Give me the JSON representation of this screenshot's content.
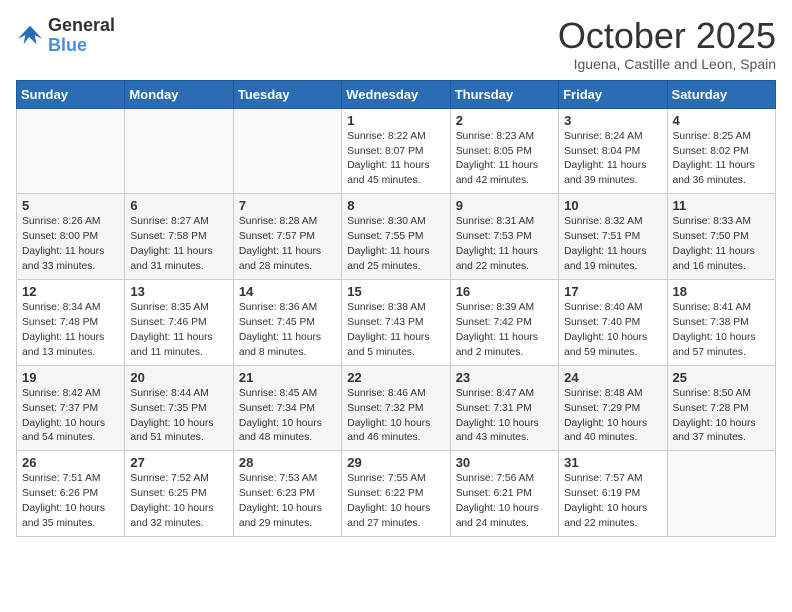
{
  "header": {
    "logo_line1": "General",
    "logo_line2": "Blue",
    "month_title": "October 2025",
    "subtitle": "Iguena, Castille and Leon, Spain"
  },
  "weekdays": [
    "Sunday",
    "Monday",
    "Tuesday",
    "Wednesday",
    "Thursday",
    "Friday",
    "Saturday"
  ],
  "weeks": [
    [
      {
        "day": "",
        "info": ""
      },
      {
        "day": "",
        "info": ""
      },
      {
        "day": "",
        "info": ""
      },
      {
        "day": "1",
        "info": "Sunrise: 8:22 AM\nSunset: 8:07 PM\nDaylight: 11 hours and 45 minutes."
      },
      {
        "day": "2",
        "info": "Sunrise: 8:23 AM\nSunset: 8:05 PM\nDaylight: 11 hours and 42 minutes."
      },
      {
        "day": "3",
        "info": "Sunrise: 8:24 AM\nSunset: 8:04 PM\nDaylight: 11 hours and 39 minutes."
      },
      {
        "day": "4",
        "info": "Sunrise: 8:25 AM\nSunset: 8:02 PM\nDaylight: 11 hours and 36 minutes."
      }
    ],
    [
      {
        "day": "5",
        "info": "Sunrise: 8:26 AM\nSunset: 8:00 PM\nDaylight: 11 hours and 33 minutes."
      },
      {
        "day": "6",
        "info": "Sunrise: 8:27 AM\nSunset: 7:58 PM\nDaylight: 11 hours and 31 minutes."
      },
      {
        "day": "7",
        "info": "Sunrise: 8:28 AM\nSunset: 7:57 PM\nDaylight: 11 hours and 28 minutes."
      },
      {
        "day": "8",
        "info": "Sunrise: 8:30 AM\nSunset: 7:55 PM\nDaylight: 11 hours and 25 minutes."
      },
      {
        "day": "9",
        "info": "Sunrise: 8:31 AM\nSunset: 7:53 PM\nDaylight: 11 hours and 22 minutes."
      },
      {
        "day": "10",
        "info": "Sunrise: 8:32 AM\nSunset: 7:51 PM\nDaylight: 11 hours and 19 minutes."
      },
      {
        "day": "11",
        "info": "Sunrise: 8:33 AM\nSunset: 7:50 PM\nDaylight: 11 hours and 16 minutes."
      }
    ],
    [
      {
        "day": "12",
        "info": "Sunrise: 8:34 AM\nSunset: 7:48 PM\nDaylight: 11 hours and 13 minutes."
      },
      {
        "day": "13",
        "info": "Sunrise: 8:35 AM\nSunset: 7:46 PM\nDaylight: 11 hours and 11 minutes."
      },
      {
        "day": "14",
        "info": "Sunrise: 8:36 AM\nSunset: 7:45 PM\nDaylight: 11 hours and 8 minutes."
      },
      {
        "day": "15",
        "info": "Sunrise: 8:38 AM\nSunset: 7:43 PM\nDaylight: 11 hours and 5 minutes."
      },
      {
        "day": "16",
        "info": "Sunrise: 8:39 AM\nSunset: 7:42 PM\nDaylight: 11 hours and 2 minutes."
      },
      {
        "day": "17",
        "info": "Sunrise: 8:40 AM\nSunset: 7:40 PM\nDaylight: 10 hours and 59 minutes."
      },
      {
        "day": "18",
        "info": "Sunrise: 8:41 AM\nSunset: 7:38 PM\nDaylight: 10 hours and 57 minutes."
      }
    ],
    [
      {
        "day": "19",
        "info": "Sunrise: 8:42 AM\nSunset: 7:37 PM\nDaylight: 10 hours and 54 minutes."
      },
      {
        "day": "20",
        "info": "Sunrise: 8:44 AM\nSunset: 7:35 PM\nDaylight: 10 hours and 51 minutes."
      },
      {
        "day": "21",
        "info": "Sunrise: 8:45 AM\nSunset: 7:34 PM\nDaylight: 10 hours and 48 minutes."
      },
      {
        "day": "22",
        "info": "Sunrise: 8:46 AM\nSunset: 7:32 PM\nDaylight: 10 hours and 46 minutes."
      },
      {
        "day": "23",
        "info": "Sunrise: 8:47 AM\nSunset: 7:31 PM\nDaylight: 10 hours and 43 minutes."
      },
      {
        "day": "24",
        "info": "Sunrise: 8:48 AM\nSunset: 7:29 PM\nDaylight: 10 hours and 40 minutes."
      },
      {
        "day": "25",
        "info": "Sunrise: 8:50 AM\nSunset: 7:28 PM\nDaylight: 10 hours and 37 minutes."
      }
    ],
    [
      {
        "day": "26",
        "info": "Sunrise: 7:51 AM\nSunset: 6:26 PM\nDaylight: 10 hours and 35 minutes."
      },
      {
        "day": "27",
        "info": "Sunrise: 7:52 AM\nSunset: 6:25 PM\nDaylight: 10 hours and 32 minutes."
      },
      {
        "day": "28",
        "info": "Sunrise: 7:53 AM\nSunset: 6:23 PM\nDaylight: 10 hours and 29 minutes."
      },
      {
        "day": "29",
        "info": "Sunrise: 7:55 AM\nSunset: 6:22 PM\nDaylight: 10 hours and 27 minutes."
      },
      {
        "day": "30",
        "info": "Sunrise: 7:56 AM\nSunset: 6:21 PM\nDaylight: 10 hours and 24 minutes."
      },
      {
        "day": "31",
        "info": "Sunrise: 7:57 AM\nSunset: 6:19 PM\nDaylight: 10 hours and 22 minutes."
      },
      {
        "day": "",
        "info": ""
      }
    ]
  ]
}
